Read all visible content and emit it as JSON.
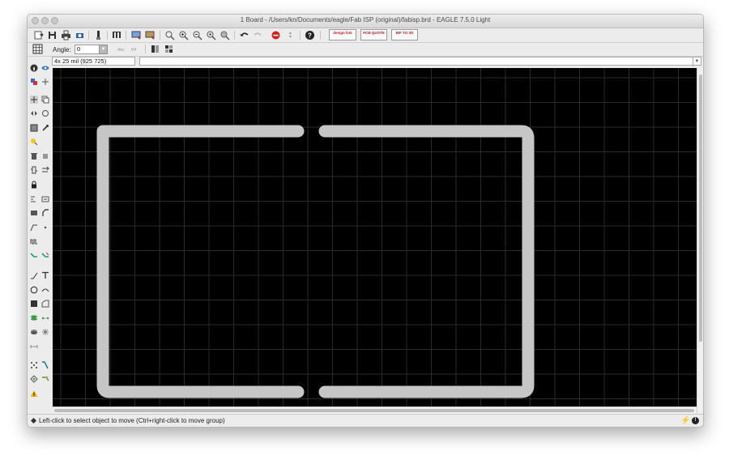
{
  "window": {
    "title": "1 Board - /Users/kn/Documents/eagle/Fab ISP (original)/fabisp.brd - EAGLE 7.5.0 Light"
  },
  "toolbar": {
    "badges": [
      {
        "label": "design link"
      },
      {
        "label": "PCB QUOTE"
      },
      {
        "label": "BIF TO 3D"
      }
    ]
  },
  "parameter_bar": {
    "angle_label": "Angle:",
    "angle_value": "0"
  },
  "command_bar": {
    "coordinates": "4x 25 mil (925 725)",
    "command_value": ""
  },
  "status_bar": {
    "message": "Left-click to select object to move (Ctrl+right-click to move group)"
  },
  "colors": {
    "canvas_background": "#000000",
    "grid_line": "#2a2a2a",
    "board_outline": "#c6c6c6"
  }
}
